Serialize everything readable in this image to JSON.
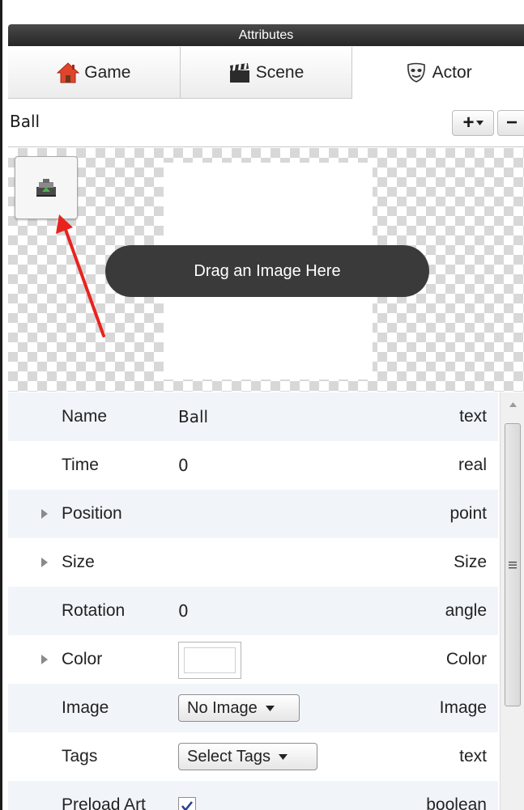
{
  "panel": {
    "title": "Attributes"
  },
  "tabs": [
    {
      "label": "Game",
      "icon": "house-icon"
    },
    {
      "label": "Scene",
      "icon": "clapperboard-icon"
    },
    {
      "label": "Actor",
      "icon": "mask-icon"
    }
  ],
  "actor": {
    "name": "Ball"
  },
  "toolbar": {
    "add_label": "+",
    "remove_label": "−"
  },
  "image_area": {
    "drop_hint": "Drag an Image Here"
  },
  "properties": [
    {
      "name": "Name",
      "value": "Ball",
      "type": "text",
      "expandable": false,
      "control": "text"
    },
    {
      "name": "Time",
      "value": "0",
      "type": "real",
      "expandable": false,
      "control": "text"
    },
    {
      "name": "Position",
      "value": "",
      "type": "point",
      "expandable": true,
      "control": "none"
    },
    {
      "name": "Size",
      "value": "",
      "type": "Size",
      "expandable": true,
      "control": "none"
    },
    {
      "name": "Rotation",
      "value": "0",
      "type": "angle",
      "expandable": false,
      "control": "text"
    },
    {
      "name": "Color",
      "value": "#ffffff",
      "type": "Color",
      "expandable": true,
      "control": "swatch"
    },
    {
      "name": "Image",
      "value": "No Image",
      "type": "Image",
      "expandable": false,
      "control": "select"
    },
    {
      "name": "Tags",
      "value": "Select Tags",
      "type": "text",
      "expandable": false,
      "control": "select"
    },
    {
      "name": "Preload Art",
      "value": "checked",
      "type": "boolean",
      "expandable": false,
      "control": "checkbox"
    }
  ],
  "colors": {
    "header": "#262626",
    "row_alt": "#f1f5fa",
    "annotation_arrow": "#e8231e"
  }
}
